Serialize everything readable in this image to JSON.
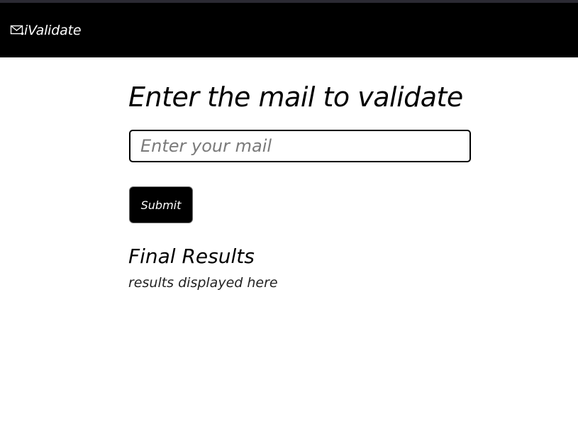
{
  "navbar": {
    "icon": "envelope-icon",
    "brand": "iValidate",
    "background": "#000000"
  },
  "main": {
    "heading": "Enter the mail to validate",
    "input": {
      "placeholder": "Enter your mail",
      "value": ""
    },
    "submit_label": "Submit",
    "results_heading": "Final Results",
    "results_text": "results displayed here"
  }
}
